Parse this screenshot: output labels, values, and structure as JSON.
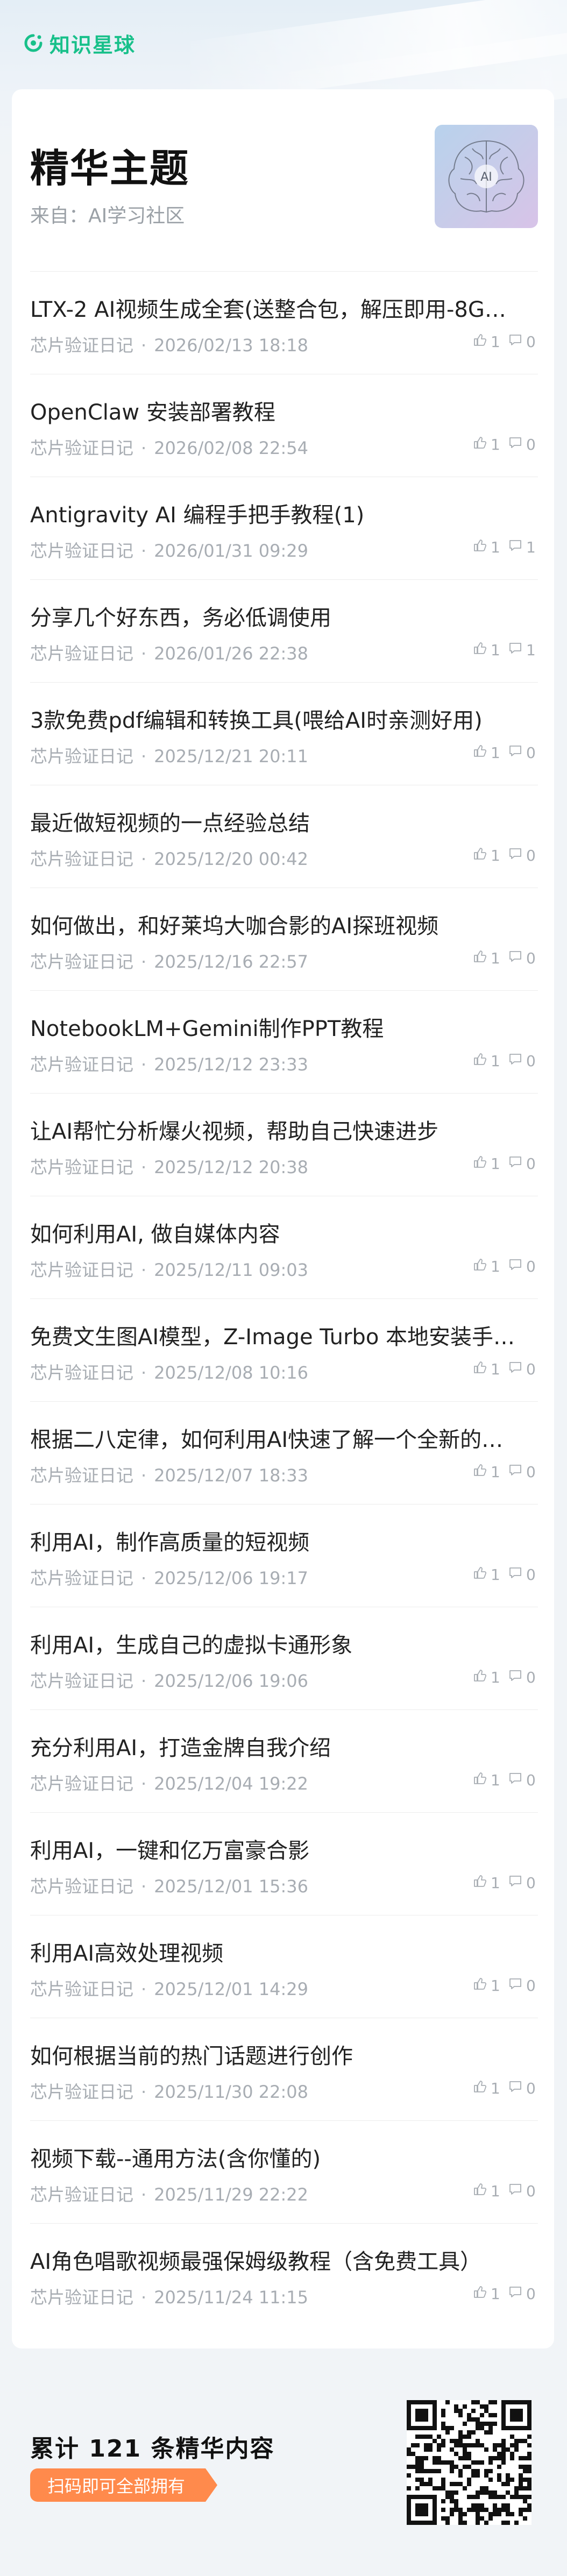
{
  "brand": {
    "name": "知识星球",
    "icon": "planet-logo-icon",
    "color": "#18c08a"
  },
  "card": {
    "title": "精华主题",
    "source": "来自：AI学习社区",
    "thumbnail": "ai-brain-image"
  },
  "items": [
    {
      "title": "LTX-2 AI视频生成全套(送整合包，解压即用-8G…",
      "author": "芯片验证日记",
      "date": "2026/02/13 18:18",
      "likes": "1",
      "comments": "0"
    },
    {
      "title": "OpenClaw 安装部署教程",
      "author": "芯片验证日记",
      "date": "2026/02/08 22:54",
      "likes": "1",
      "comments": "0"
    },
    {
      "title": "Antigravity AI 编程手把手教程(1)",
      "author": "芯片验证日记",
      "date": "2026/01/31 09:29",
      "likes": "1",
      "comments": "1"
    },
    {
      "title": "分享几个好东西，务必低调使用",
      "author": "芯片验证日记",
      "date": "2026/01/26 22:38",
      "likes": "1",
      "comments": "1"
    },
    {
      "title": "3款免费pdf编辑和转换工具(喂给AI时亲测好用)",
      "author": "芯片验证日记",
      "date": "2025/12/21 20:11",
      "likes": "1",
      "comments": "0"
    },
    {
      "title": "最近做短视频的一点经验总结",
      "author": "芯片验证日记",
      "date": "2025/12/20 00:42",
      "likes": "1",
      "comments": "0"
    },
    {
      "title": "如何做出，和好莱坞大咖合影的AI探班视频",
      "author": "芯片验证日记",
      "date": "2025/12/16 22:57",
      "likes": "1",
      "comments": "0"
    },
    {
      "title": "NotebookLM+Gemini制作PPT教程",
      "author": "芯片验证日记",
      "date": "2025/12/12 23:33",
      "likes": "1",
      "comments": "0"
    },
    {
      "title": "让AI帮忙分析爆火视频，帮助自己快速进步",
      "author": "芯片验证日记",
      "date": "2025/12/12 20:38",
      "likes": "1",
      "comments": "0"
    },
    {
      "title": "如何利用AI, 做自媒体内容",
      "author": "芯片验证日记",
      "date": "2025/12/11 09:03",
      "likes": "1",
      "comments": "0"
    },
    {
      "title": "免费文生图AI模型，Z-Image Turbo 本地安装手…",
      "author": "芯片验证日记",
      "date": "2025/12/08 10:16",
      "likes": "1",
      "comments": "0"
    },
    {
      "title": "根据二八定律，如何利用AI快速了解一个全新的…",
      "author": "芯片验证日记",
      "date": "2025/12/07 18:33",
      "likes": "1",
      "comments": "0"
    },
    {
      "title": "利用AI，制作高质量的短视频",
      "author": "芯片验证日记",
      "date": "2025/12/06 19:17",
      "likes": "1",
      "comments": "0"
    },
    {
      "title": "利用AI，生成自己的虚拟卡通形象",
      "author": "芯片验证日记",
      "date": "2025/12/06 19:06",
      "likes": "1",
      "comments": "0"
    },
    {
      "title": "充分利用AI，打造金牌自我介绍",
      "author": "芯片验证日记",
      "date": "2025/12/04 19:22",
      "likes": "1",
      "comments": "0"
    },
    {
      "title": "利用AI，一键和亿万富豪合影",
      "author": "芯片验证日记",
      "date": "2025/12/01 15:36",
      "likes": "1",
      "comments": "0"
    },
    {
      "title": "利用AI高效处理视频",
      "author": "芯片验证日记",
      "date": "2025/12/01 14:29",
      "likes": "1",
      "comments": "0"
    },
    {
      "title": "如何根据当前的热门话题进行创作",
      "author": "芯片验证日记",
      "date": "2025/11/30 22:08",
      "likes": "1",
      "comments": "0"
    },
    {
      "title": "视频下载--通用方法(含你懂的)",
      "author": "芯片验证日记",
      "date": "2025/11/29 22:22",
      "likes": "1",
      "comments": "0"
    },
    {
      "title": "AI角色唱歌视频最强保姆级教程（含免费工具）",
      "author": "芯片验证日记",
      "date": "2025/11/24 11:15",
      "likes": "1",
      "comments": "0"
    }
  ],
  "footer": {
    "total": "累计 121 条精华内容",
    "cta": "扫码即可全部拥有",
    "cta_color": "#ff8a4c",
    "qr": "qr-code-image"
  }
}
